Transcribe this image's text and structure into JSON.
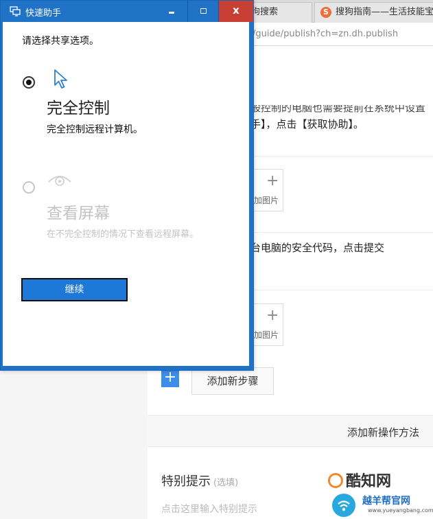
{
  "browser": {
    "tabs": [
      {
        "label": "狗搜索"
      },
      {
        "label": "搜狗指南——生活技能宝",
        "icon": "sogou-s-icon",
        "icon_glyph": "S"
      }
    ],
    "url": "/guide/publish?ch=zn.dh.publish",
    "content": {
      "step1_line1": "般控制的电脑也需要提前在系统中设置",
      "step1_line2": "手】，点击【获取协助】。",
      "add_image_label": "加图片",
      "step2_text": "台电脑的安全代码，点击提交",
      "add_step_label": "添加新步骤",
      "add_method_label": "添加新操作方法",
      "tips_title": "特别提示",
      "tips_optional": "(选填)",
      "tips_placeholder": "点击这里输入特别提示"
    }
  },
  "watermark": {
    "brand": "酷知网",
    "site_cn": "越羊帮官网",
    "site_url": "www.yueyangbang.com"
  },
  "quick_assist": {
    "title": "快速助手",
    "close_glyph": "x",
    "prompt": "请选择共享选项。",
    "options": [
      {
        "title": "完全控制",
        "description": "完全控制远程计算机。",
        "selected": true,
        "enabled": true,
        "icon": "cursor-icon"
      },
      {
        "title": "查看屏幕",
        "description": "在不完全控制的情况下查看远程屏幕。",
        "selected": false,
        "enabled": false,
        "icon": "eye-icon"
      }
    ],
    "continue_label": "继续"
  },
  "colors": {
    "titlebar": "#1f72c6",
    "close_button": "#c84034",
    "continue_button": "#1e78d7",
    "disabled_text": "#c3c3c3"
  }
}
